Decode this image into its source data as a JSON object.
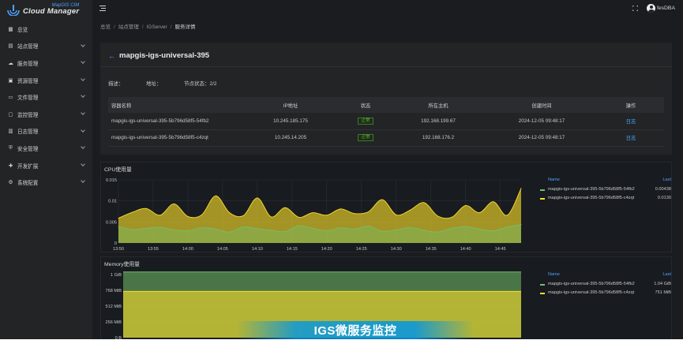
{
  "app": {
    "logo_sub": "MapGIS CIM",
    "logo_main": "Cloud Manager"
  },
  "sidebar": {
    "items": [
      {
        "label": "总览",
        "icon": "grid-icon",
        "expandable": false
      },
      {
        "label": "站点管理",
        "icon": "site-icon",
        "expandable": true
      },
      {
        "label": "服务管理",
        "icon": "cloud-icon",
        "expandable": true
      },
      {
        "label": "资源管理",
        "icon": "resource-icon",
        "expandable": true
      },
      {
        "label": "文件管理",
        "icon": "folder-icon",
        "expandable": true
      },
      {
        "label": "监控管理",
        "icon": "monitor-icon",
        "expandable": true
      },
      {
        "label": "日志管理",
        "icon": "log-icon",
        "expandable": true
      },
      {
        "label": "安全管理",
        "icon": "shield-icon",
        "expandable": true
      },
      {
        "label": "开发扩展",
        "icon": "puzzle-icon",
        "expandable": true
      },
      {
        "label": "系统配置",
        "icon": "gear-icon",
        "expandable": true
      }
    ]
  },
  "header": {
    "username": "fesDBA"
  },
  "breadcrumb": [
    "总览",
    "站点管理",
    "IGServer",
    "服务详情"
  ],
  "detail": {
    "title": "mapgis-igs-universal-395",
    "desc_label": "描述：",
    "address_label": "地址：",
    "node_status_label": "节点状态：",
    "node_status_value": "2/2",
    "table": {
      "headers": [
        "容器名称",
        "IP地址",
        "状态",
        "所在主机",
        "创建时间",
        "操作"
      ],
      "rows": [
        [
          "mapgis-igs-universal-395-5b796d58f5-54fb2",
          "10.245.185.175",
          "正常",
          "192.168.199.67",
          "2024-12-05 09:48:17",
          "日志"
        ],
        [
          "mapgis-igs-universal-395-5b796d58f5-c4zqt",
          "10.245.14.205",
          "正常",
          "192.168.176.2",
          "2024-12-05 09:48:17",
          "日志"
        ]
      ]
    }
  },
  "cpu_panel": {
    "title": "CPU使用量",
    "legend_name_header": "Name",
    "legend_last_header": "Last",
    "legend": [
      {
        "name": "mapgis-igs-universal-395-5b796d58f5-54fb2",
        "last": "0.00438",
        "color": "#73bf69"
      },
      {
        "name": "mapgis-igs-universal-395-5b796d58f5-c4zqt",
        "last": "0.0130",
        "color": "#fade2a"
      }
    ]
  },
  "mem_panel": {
    "title": "Memory使用量",
    "legend_name_header": "Name",
    "legend_last_header": "Last",
    "legend": [
      {
        "name": "mapgis-igs-universal-395-5b796d58f5-54fb2",
        "last": "1.04 GiB",
        "color": "#73bf69"
      },
      {
        "name": "mapgis-igs-universal-395-5b796d58f5-c4zqt",
        "last": "751 MiB",
        "color": "#fade2a"
      }
    ]
  },
  "chart_data": [
    {
      "type": "area",
      "title": "CPU使用量",
      "x": [
        "13:50",
        "13:52",
        "13:54",
        "13:56",
        "13:58",
        "14:00",
        "14:02",
        "14:04",
        "14:06",
        "14:08",
        "14:10",
        "14:12",
        "14:14",
        "14:16",
        "14:18",
        "14:20",
        "14:22",
        "14:24",
        "14:26",
        "14:28",
        "14:30",
        "14:32",
        "14:34",
        "14:36",
        "14:38",
        "14:40",
        "14:42",
        "14:44",
        "14:46",
        "14:48"
      ],
      "x_ticks": [
        "13:50",
        "13:55",
        "14:00",
        "14:05",
        "14:10",
        "14:15",
        "14:20",
        "14:25",
        "14:30",
        "14:35",
        "14:40",
        "14:45"
      ],
      "y_ticks": [
        "0",
        "0.005",
        "0.01",
        "0.015"
      ],
      "ylim": [
        0,
        0.015
      ],
      "series": [
        {
          "name": "mapgis-igs-universal-395-5b796d58f5-54fb2",
          "color": "#73bf69",
          "values": [
            0.0039,
            0.0032,
            0.0035,
            0.0037,
            0.0031,
            0.0029,
            0.0036,
            0.0033,
            0.0026,
            0.0038,
            0.0034,
            0.003,
            0.0027,
            0.0041,
            0.0035,
            0.0029,
            0.0036,
            0.0033,
            0.004,
            0.0028,
            0.0031,
            0.0037,
            0.003,
            0.0026,
            0.0035,
            0.0039,
            0.0033,
            0.0029,
            0.0038,
            0.00438
          ]
        },
        {
          "name": "mapgis-igs-universal-395-5b796d58f5-c4zqt",
          "color": "#fade2a",
          "values": [
            0.0059,
            0.0073,
            0.0082,
            0.0066,
            0.0093,
            0.0063,
            0.0067,
            0.0112,
            0.0072,
            0.0065,
            0.0107,
            0.0062,
            0.0084,
            0.0061,
            0.0072,
            0.0066,
            0.0081,
            0.007,
            0.0074,
            0.0103,
            0.0067,
            0.0078,
            0.0096,
            0.0064,
            0.0061,
            0.0089,
            0.0072,
            0.0098,
            0.0066,
            0.013
          ]
        }
      ]
    },
    {
      "type": "area",
      "title": "Memory使用量",
      "y_ticks": [
        "0 B",
        "256 MiB",
        "512 MiB",
        "768 MiB",
        "1 GiB"
      ],
      "ylim": [
        0,
        1024
      ],
      "unit": "MiB",
      "series": [
        {
          "name": "mapgis-igs-universal-395-5b796d58f5-54fb2",
          "color": "#73bf69",
          "last_value": 1065
        },
        {
          "name": "mapgis-igs-universal-395-5b796d58f5-c4zqt",
          "color": "#fade2a",
          "last_value": 751
        }
      ]
    }
  ],
  "caption": "IGS微服务监控"
}
